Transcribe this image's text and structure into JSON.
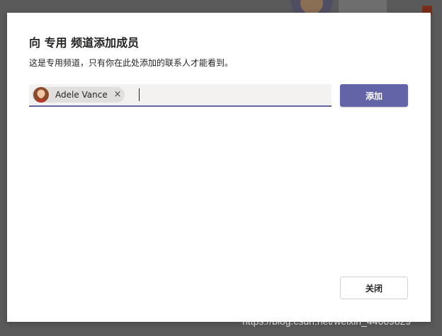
{
  "dialog": {
    "title": "向 专用 频道添加成员",
    "subtitle": "这是专用频道，只有你在此处添加的联系人才能看到。"
  },
  "picker": {
    "selected": [
      {
        "name": "Adele Vance",
        "avatar": "adele-vance-avatar"
      }
    ],
    "remove_icon": "×",
    "input_value": ""
  },
  "buttons": {
    "add_label": "添加",
    "close_label": "关闭"
  },
  "colors": {
    "accent": "#6264a7",
    "text": "#252423",
    "input_bg": "#f3f2f1",
    "overlay": "#5a5a5a"
  },
  "watermark": "https://blog.csdn.net/weixin_44669829"
}
